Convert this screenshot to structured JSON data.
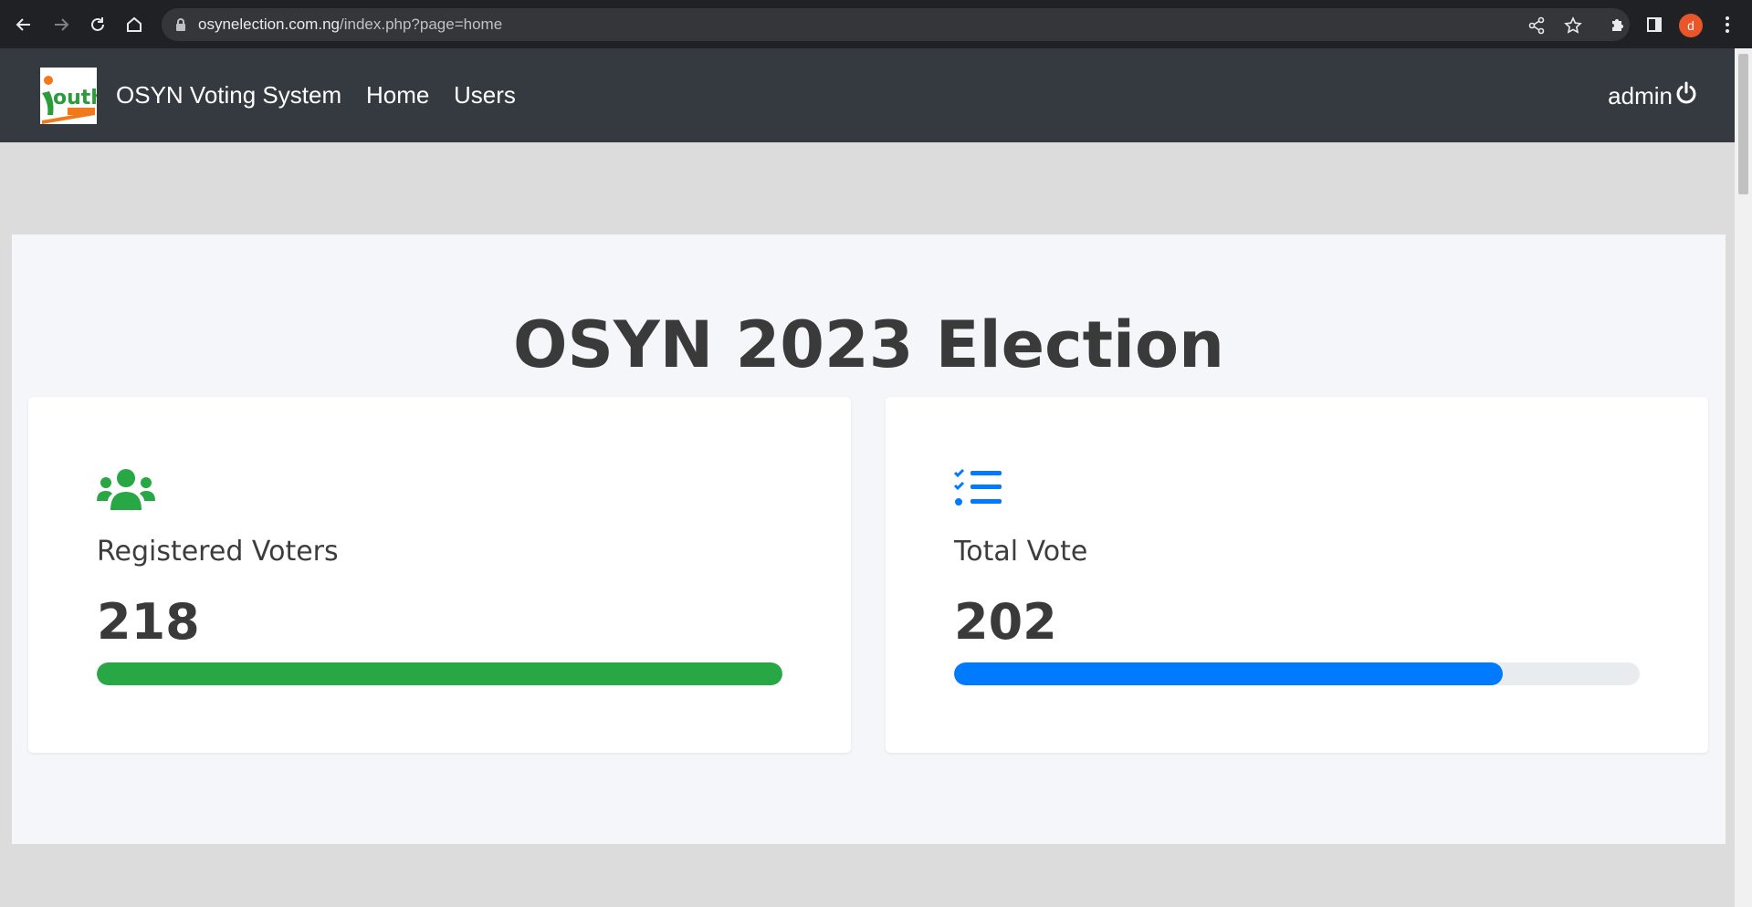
{
  "browser": {
    "url_host": "osynelection.com.ng",
    "url_path": "/index.php?page=home",
    "profile_initial": "d"
  },
  "navbar": {
    "brand": "OSYN Voting System",
    "links": [
      "Home",
      "Users"
    ],
    "user": "admin",
    "bg_color": "#343a40"
  },
  "main": {
    "title": "OSYN 2023 Election",
    "cards": [
      {
        "label": "Registered Voters",
        "value": "218",
        "progress_fraction": 1.0,
        "color": "#28a745",
        "icon": "users-icon"
      },
      {
        "label": "Total Vote",
        "value": "202",
        "progress_fraction": 0.8,
        "color": "#007bff",
        "icon": "tasks-checklist-icon"
      }
    ]
  }
}
